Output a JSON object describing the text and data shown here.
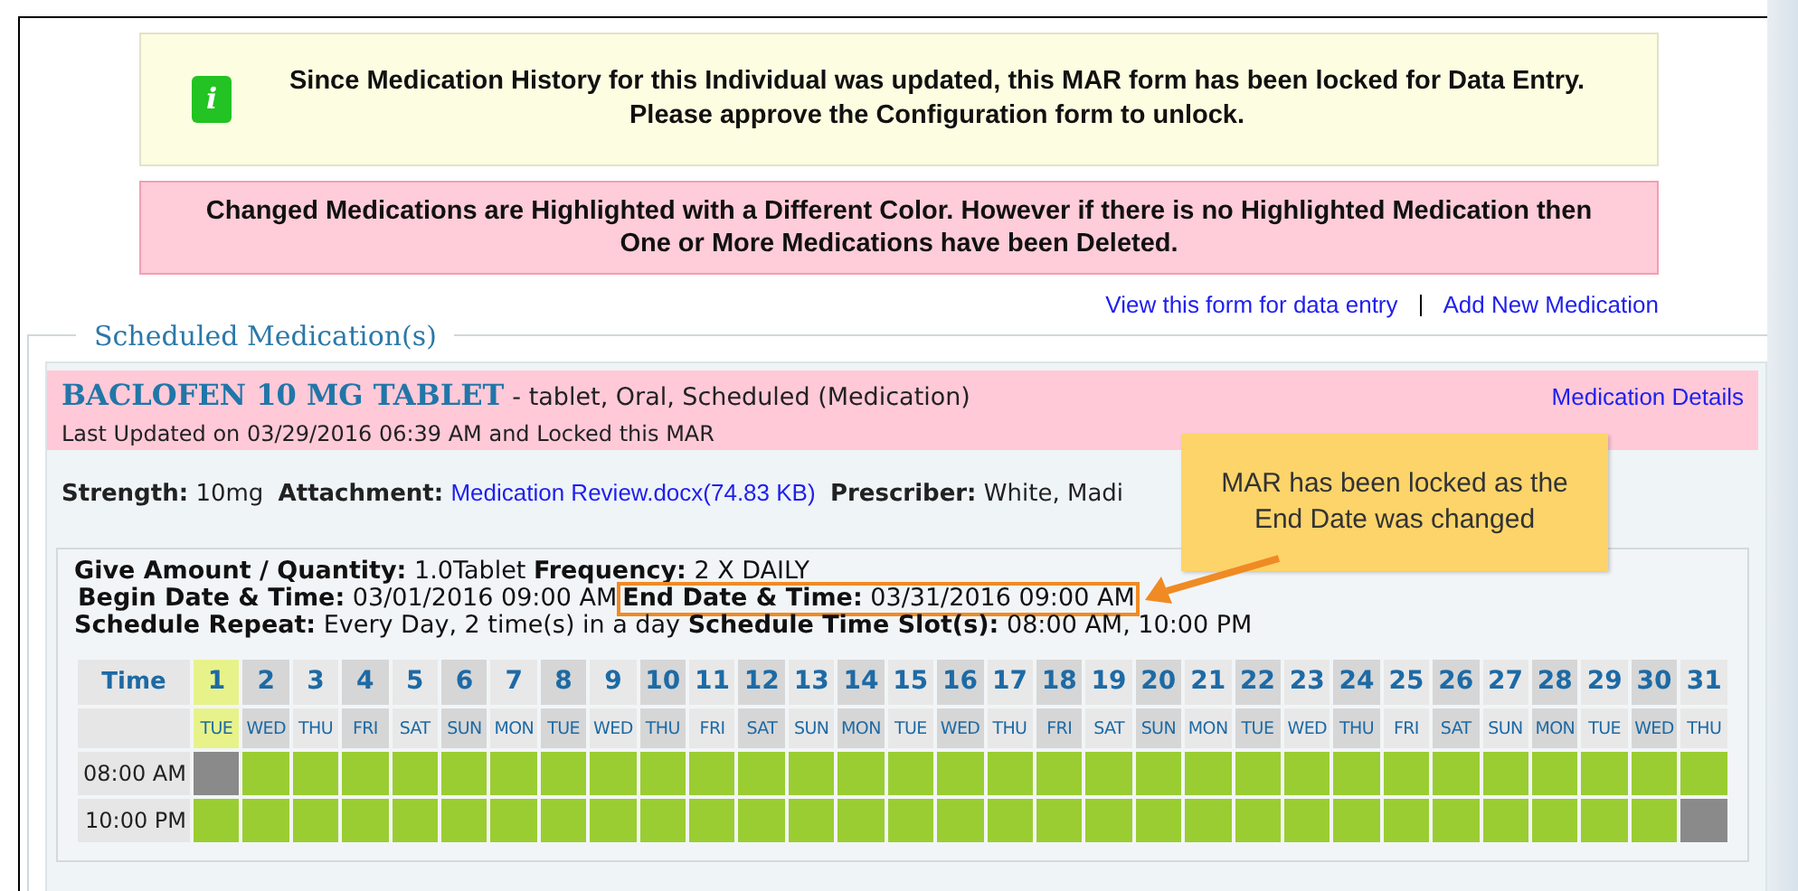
{
  "notice": {
    "icon": "i",
    "text": "Since Medication History for this Individual was updated, this MAR form has been locked for Data Entry. Please approve the Configuration form to unlock."
  },
  "warning": {
    "text": "Changed Medications are Highlighted with a Different Color. However if there is no Highlighted Medication then One or More Medications have been Deleted."
  },
  "links": [
    "View this form for data entry",
    "Add New Medication"
  ],
  "section": {
    "title": "Scheduled Medication(s)"
  },
  "medication": {
    "name": "BACLOFEN 10 MG TABLET",
    "description": "- tablet, Oral, Scheduled (Medication)",
    "details_link": "Medication Details",
    "updated": "Last Updated on 03/29/2016 06:39 AM and Locked this MAR",
    "changed": true,
    "strength_label": "Strength:",
    "strength": "10mg",
    "attachment_label": "Attachment:",
    "attachment": "Medication Review.docx(74.83 KB)",
    "prescriber_label": "Prescriber:",
    "prescriber": "White, Madi",
    "amount_label": "Give Amount / Quantity:",
    "amount": "1.0Tablet",
    "frequency_label": "Frequency:",
    "frequency": "2 X DAILY",
    "begin_label": "Begin Date & Time:",
    "begin": "03/01/2016 09:00 AM",
    "end_label": "End Date & Time:",
    "end": "03/31/2016 09:00 AM",
    "end_highlighted": true,
    "repeat_label": "Schedule Repeat:",
    "repeat": "Every Day, 2 time(s) in a day",
    "slots_label": "Schedule Time Slot(s):",
    "slots": "08:00 AM, 10:00 PM"
  },
  "callout": {
    "text": "MAR has been locked as the End Date was changed"
  },
  "grid": {
    "time_header": "Time",
    "days": [
      {
        "day": "1",
        "weekday": "TUE",
        "selected": true
      },
      {
        "day": "2",
        "weekday": "WED",
        "selected": false
      },
      {
        "day": "3",
        "weekday": "THU",
        "selected": false
      },
      {
        "day": "4",
        "weekday": "FRI",
        "selected": false
      },
      {
        "day": "5",
        "weekday": "SAT",
        "selected": false
      },
      {
        "day": "6",
        "weekday": "SUN",
        "selected": false
      },
      {
        "day": "7",
        "weekday": "MON",
        "selected": false
      },
      {
        "day": "8",
        "weekday": "TUE",
        "selected": false
      },
      {
        "day": "9",
        "weekday": "WED",
        "selected": false
      },
      {
        "day": "10",
        "weekday": "THU",
        "selected": false
      },
      {
        "day": "11",
        "weekday": "FRI",
        "selected": false
      },
      {
        "day": "12",
        "weekday": "SAT",
        "selected": false
      },
      {
        "day": "13",
        "weekday": "SUN",
        "selected": false
      },
      {
        "day": "14",
        "weekday": "MON",
        "selected": false
      },
      {
        "day": "15",
        "weekday": "TUE",
        "selected": false
      },
      {
        "day": "16",
        "weekday": "WED",
        "selected": false
      },
      {
        "day": "17",
        "weekday": "THU",
        "selected": false
      },
      {
        "day": "18",
        "weekday": "FRI",
        "selected": false
      },
      {
        "day": "19",
        "weekday": "SAT",
        "selected": false
      },
      {
        "day": "20",
        "weekday": "SUN",
        "selected": false
      },
      {
        "day": "21",
        "weekday": "MON",
        "selected": false
      },
      {
        "day": "22",
        "weekday": "TUE",
        "selected": false
      },
      {
        "day": "23",
        "weekday": "WED",
        "selected": false
      },
      {
        "day": "24",
        "weekday": "THU",
        "selected": false
      },
      {
        "day": "25",
        "weekday": "FRI",
        "selected": false
      },
      {
        "day": "26",
        "weekday": "SAT",
        "selected": false
      },
      {
        "day": "27",
        "weekday": "SUN",
        "selected": false
      },
      {
        "day": "28",
        "weekday": "MON",
        "selected": false
      },
      {
        "day": "29",
        "weekday": "TUE",
        "selected": false
      },
      {
        "day": "30",
        "weekday": "WED",
        "selected": false
      },
      {
        "day": "31",
        "weekday": "THU",
        "selected": false
      }
    ],
    "rows": [
      {
        "time": "08:00 AM",
        "active": [
          false,
          true,
          true,
          true,
          true,
          true,
          true,
          true,
          true,
          true,
          true,
          true,
          true,
          true,
          true,
          true,
          true,
          true,
          true,
          true,
          true,
          true,
          true,
          true,
          true,
          true,
          true,
          true,
          true,
          true,
          true
        ]
      },
      {
        "time": "10:00 PM",
        "active": [
          true,
          true,
          true,
          true,
          true,
          true,
          true,
          true,
          true,
          true,
          true,
          true,
          true,
          true,
          true,
          true,
          true,
          true,
          true,
          true,
          true,
          true,
          true,
          true,
          true,
          true,
          true,
          true,
          true,
          true,
          false
        ]
      }
    ]
  }
}
